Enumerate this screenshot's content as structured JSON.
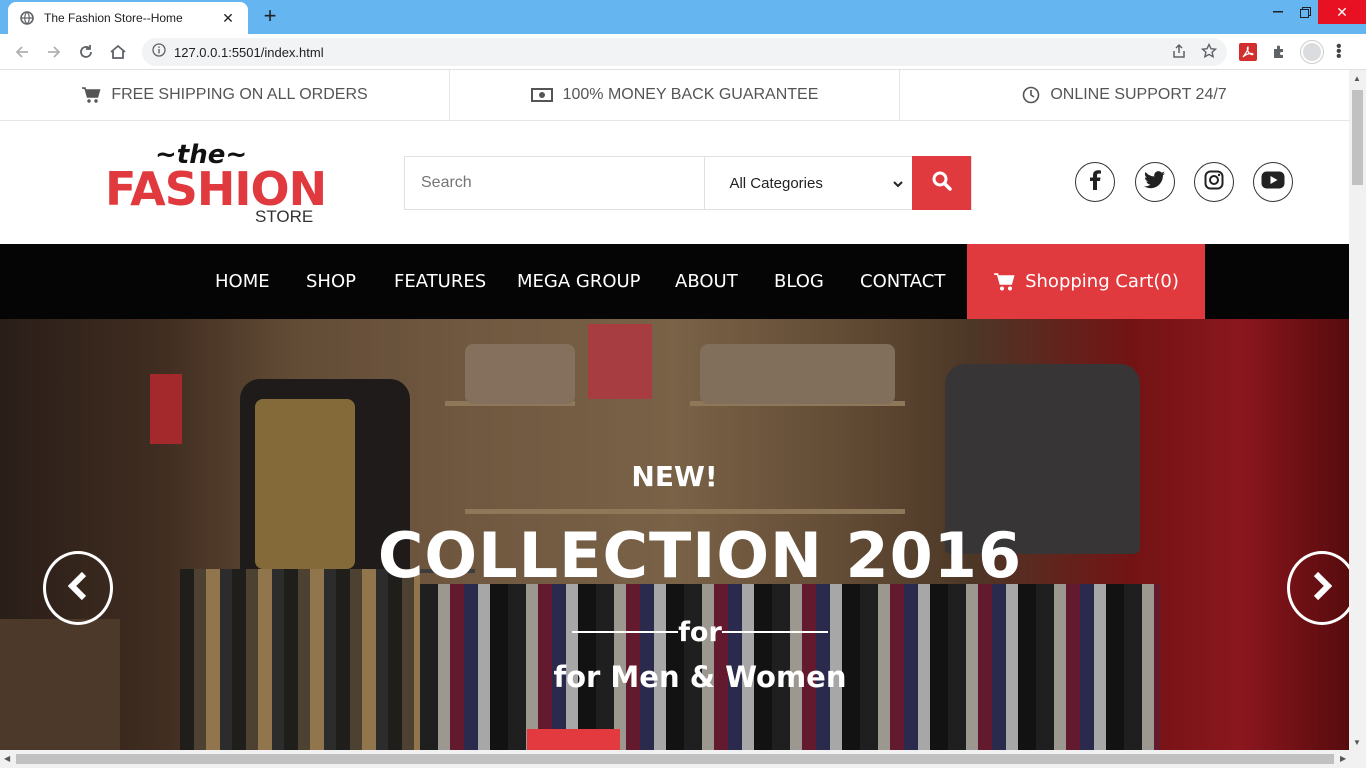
{
  "browser": {
    "tab_title": "The Fashion Store--Home",
    "url": "127.0.0.1:5501/index.html"
  },
  "topbar": {
    "shipping": "FREE SHIPPING ON ALL ORDERS",
    "money_back": "100% MONEY BACK GUARANTEE",
    "support": "ONLINE SUPPORT 24/7"
  },
  "logo": {
    "the": "~the~",
    "fashion": "FASHION",
    "store": "STORE"
  },
  "search": {
    "placeholder": "Search",
    "category": "All Categories"
  },
  "social": [
    "facebook-icon",
    "twitter-icon",
    "instagram-icon",
    "youtube-icon"
  ],
  "nav": {
    "items": [
      "HOME",
      "SHOP",
      "FEATURES",
      "MEGA GROUP",
      "ABOUT",
      "BLOG",
      "CONTACT"
    ],
    "cart": "Shopping Cart(0)"
  },
  "hero": {
    "new": "NEW!",
    "headline": "COLLECTION 2016",
    "for": "for",
    "sub": "for Men & Women"
  },
  "colors": {
    "accent": "#e0393e",
    "nav_bg": "#050505",
    "chrome": "#64b5f0"
  }
}
